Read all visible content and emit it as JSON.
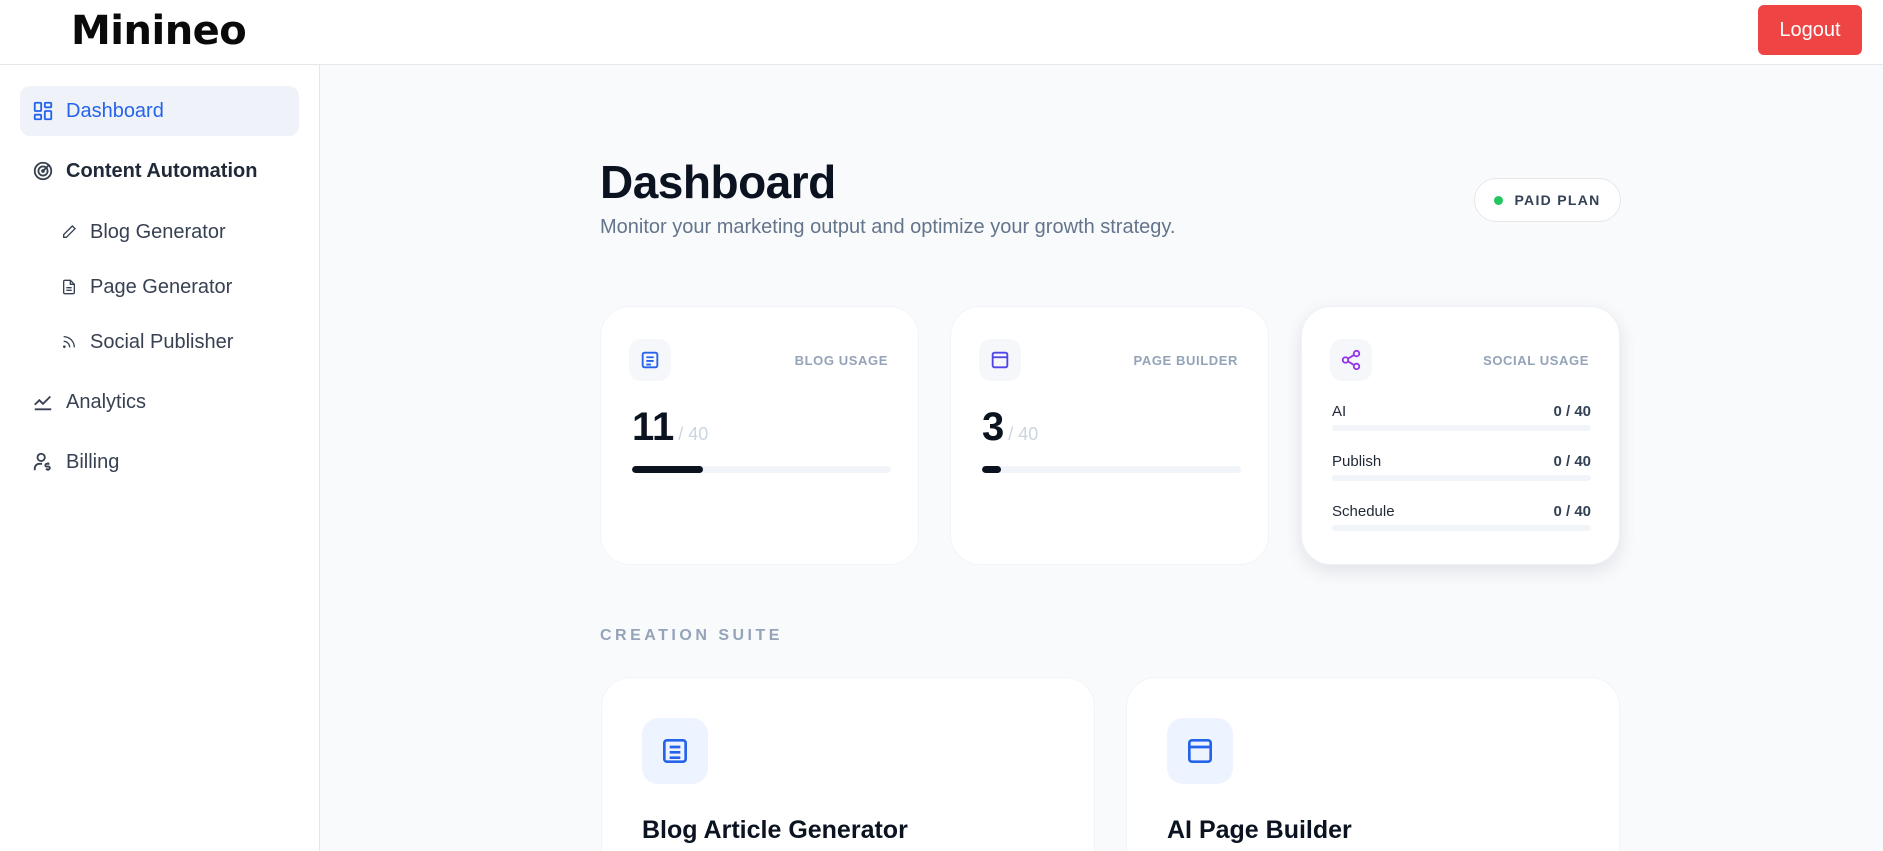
{
  "app": {
    "logo": "Minineo",
    "logout_label": "Logout"
  },
  "sidebar": {
    "dashboard": "Dashboard",
    "content_automation": "Content Automation",
    "blog_generator": "Blog Generator",
    "page_generator": "Page Generator",
    "social_publisher": "Social Publisher",
    "analytics": "Analytics",
    "billing": "Billing"
  },
  "header": {
    "title": "Dashboard",
    "subtitle": "Monitor your marketing output and optimize your growth strategy.",
    "plan_badge": "PAID PLAN"
  },
  "stats": {
    "blog": {
      "label": "BLOG USAGE",
      "value": "11",
      "limit": "/ 40",
      "fraction": 0.275
    },
    "page": {
      "label": "PAGE BUILDER",
      "value": "3",
      "limit": "/ 40",
      "fraction": 0.075
    },
    "social": {
      "label": "SOCIAL USAGE",
      "rows": [
        {
          "label": "AI",
          "value": "0 / 40"
        },
        {
          "label": "Publish",
          "value": "0 / 40"
        },
        {
          "label": "Schedule",
          "value": "0 / 40"
        }
      ]
    }
  },
  "creation_suite": {
    "label": "CREATION SUITE",
    "cards": [
      {
        "title": "Blog Article Generator"
      },
      {
        "title": "AI Page Builder"
      }
    ]
  },
  "colors": {
    "accent": "#2563eb",
    "logout": "#ef4444",
    "status_dot": "#22c55e",
    "social": "#9333ea"
  }
}
